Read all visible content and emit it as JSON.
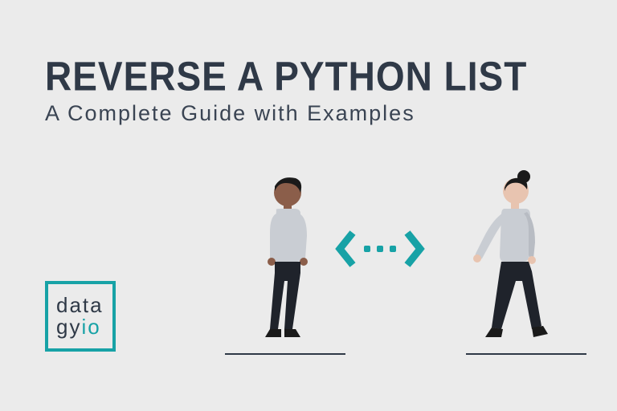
{
  "title": "REVERSE A PYTHON LIST",
  "subtitle": "A Complete Guide with Examples",
  "logo": {
    "line1": "data",
    "line2_a": "gy",
    "line2_b": "io"
  },
  "colors": {
    "accent": "#17a2a6",
    "dark": "#2f3947",
    "bg": "#ebebeb"
  }
}
